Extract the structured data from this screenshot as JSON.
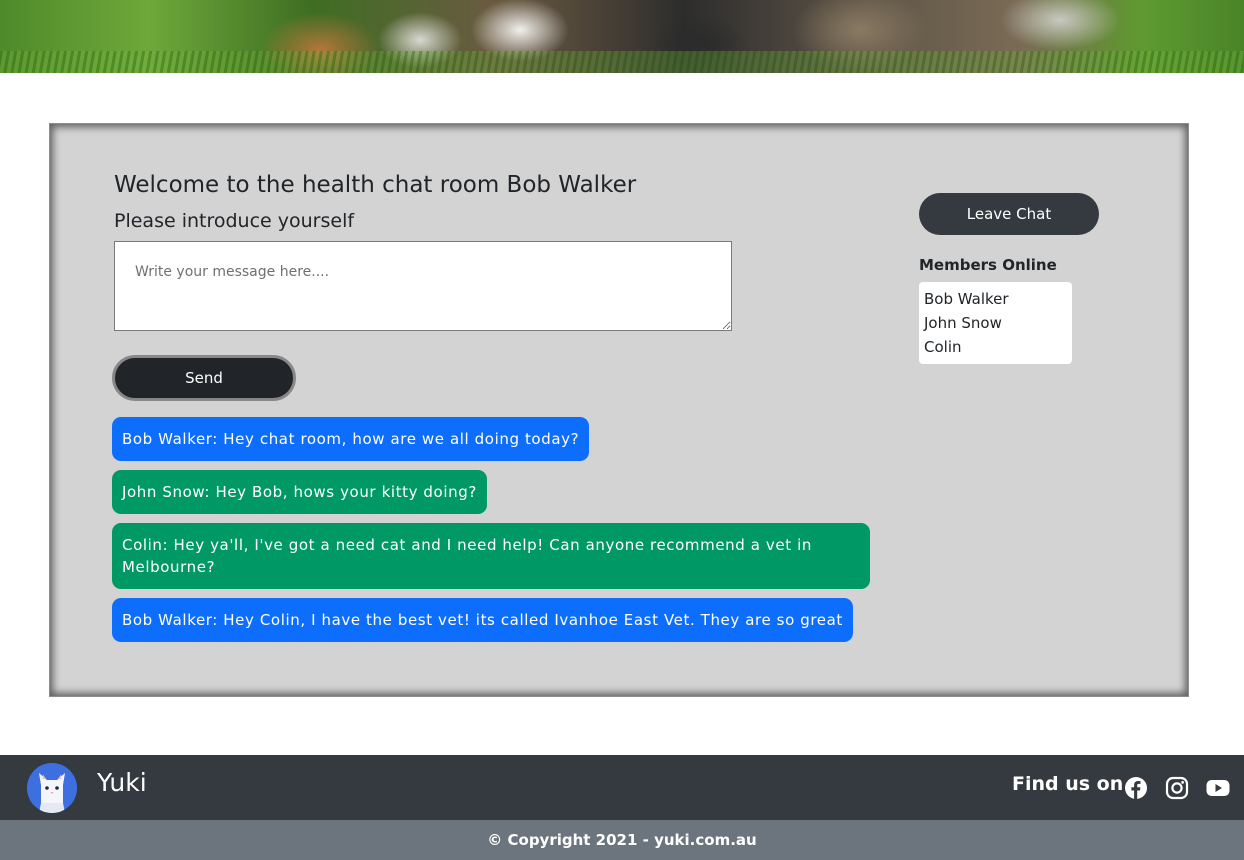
{
  "chat": {
    "title": "Welcome to the health chat room Bob Walker",
    "subtitle": "Please introduce yourself",
    "input_placeholder": "Write your message here....",
    "input_value": "",
    "send_label": "Send",
    "messages": [
      {
        "text": "Bob Walker: Hey chat room, how are we all doing today?",
        "color": "#0d6efd"
      },
      {
        "text": "John Snow: Hey Bob, hows your kitty doing?",
        "color": "#009966"
      },
      {
        "text": "Colin: Hey ya'll, I've got a need cat and I need help! Can anyone recommend a vet in Melbourne?",
        "color": "#009966"
      },
      {
        "text": "Bob Walker: Hey Colin, I have the best vet! its called Ivanhoe East Vet. They are so great",
        "color": "#0d6efd"
      }
    ]
  },
  "sidebar": {
    "leave_label": "Leave Chat",
    "members_title": "Members Online",
    "members": [
      "Bob Walker",
      "John Snow",
      "Colin"
    ]
  },
  "footer": {
    "brand": "Yuki",
    "find_us": "Find us on",
    "social_icons": [
      "facebook-icon",
      "instagram-icon",
      "youtube-icon"
    ],
    "copyright": "© Copyright 2021 - yuki.com.au"
  },
  "colors": {
    "panel_bg": "#d3d3d3",
    "dark": "#212529",
    "footer_bg": "#343a40",
    "copyright_bg": "#6c757d",
    "blue_bubble": "#0d6efd",
    "green_bubble": "#009966"
  }
}
